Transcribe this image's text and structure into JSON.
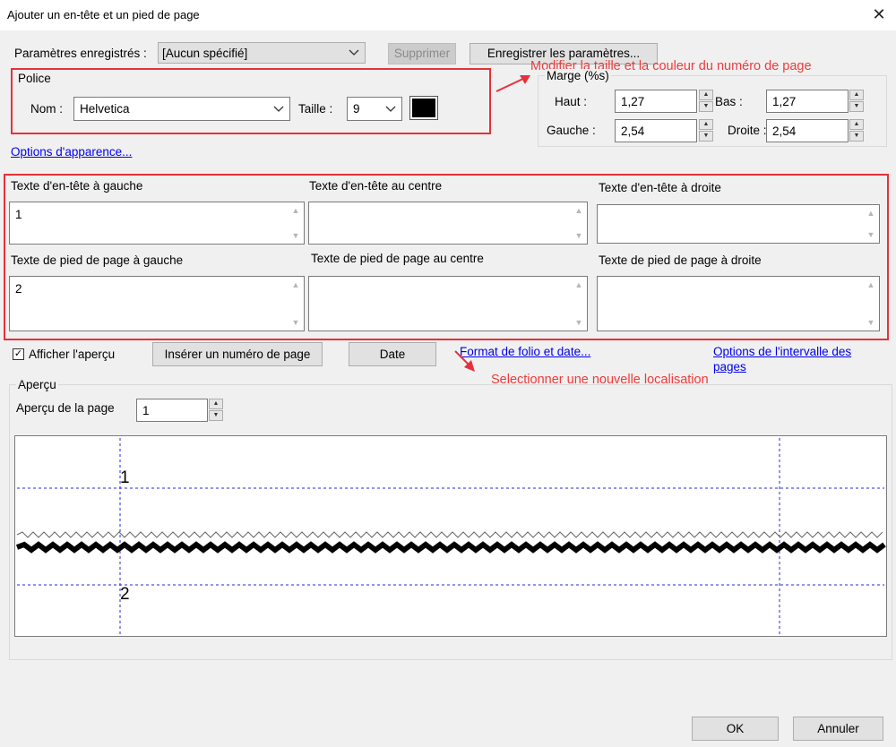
{
  "window": {
    "title": "Ajouter un en-tête et un pied de page",
    "close_glyph": "✕"
  },
  "saved_settings": {
    "label": "Paramètres enregistrés :",
    "value": "[Aucun spécifié]",
    "delete_button": "Supprimer",
    "save_button": "Enregistrer les paramètres..."
  },
  "font": {
    "group_label": "Police",
    "name_label": "Nom :",
    "name_value": "Helvetica",
    "size_label": "Taille :",
    "size_value": "9",
    "color": "#000000"
  },
  "appearance_link": "Options d'apparence...",
  "margin": {
    "group_label": "Marge (%s)",
    "top_label": "Haut :",
    "top_value": "1,27",
    "bottom_label": "Bas :",
    "bottom_value": "1,27",
    "left_label": "Gauche :",
    "left_value": "2,54",
    "right_label": "Droite :",
    "right_value": "2,54"
  },
  "annotations": {
    "font_note": "Modifier la taille et la couleur du numéro de page",
    "location_note": "Selectionner une nouvelle localisation",
    "color": "#e6313a"
  },
  "header": {
    "left_label": "Texte d'en-tête à gauche",
    "left_value": "1",
    "center_label": "Texte d'en-tête au centre",
    "center_value": "",
    "right_label": "Texte d'en-tête à droite",
    "right_value": ""
  },
  "footer": {
    "left_label": "Texte de pied de page à gauche",
    "left_value": "2",
    "center_label": "Texte de pied de page au centre",
    "center_value": "",
    "right_label": "Texte de pied de page à droite",
    "right_value": ""
  },
  "actions": {
    "show_preview_label": "Afficher l'aperçu",
    "show_preview_checked": true,
    "insert_page_number": "Insérer un numéro de page",
    "date": "Date",
    "folio_format_link": "Format de folio et date...",
    "page_range_link_line1": "Options de l'intervalle des",
    "page_range_link_line2": "pages"
  },
  "preview": {
    "group_label": "Aperçu",
    "page_label": "Aperçu de la page",
    "page_value": "1",
    "header_text": "1",
    "footer_text": "2"
  },
  "footer_buttons": {
    "ok": "OK",
    "cancel": "Annuler"
  }
}
